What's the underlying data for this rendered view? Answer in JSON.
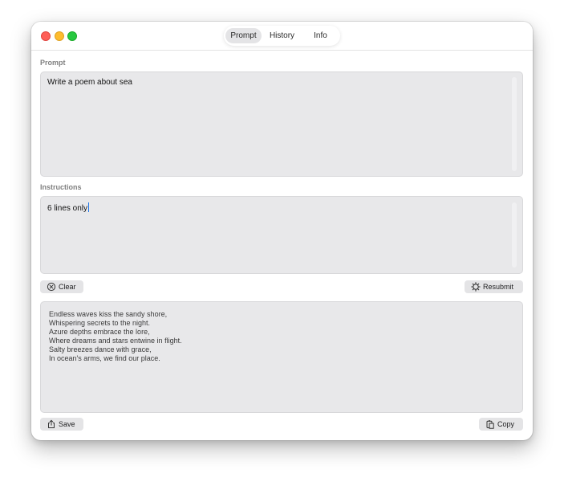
{
  "tabs": [
    {
      "label": "Prompt",
      "active": true
    },
    {
      "label": "History",
      "active": false
    },
    {
      "label": "Info",
      "active": false
    }
  ],
  "prompt": {
    "label": "Prompt",
    "value": "Write a poem about sea"
  },
  "instructions": {
    "label": "Instructions",
    "value": "6 lines only"
  },
  "actions": {
    "clear_label": "Clear",
    "resubmit_label": "Resubmit",
    "save_label": "Save",
    "copy_label": "Copy"
  },
  "output": {
    "lines": [
      "Endless waves kiss the sandy shore,",
      "Whispering secrets to the night.",
      "Azure depths embrace the lore,",
      "Where dreams and stars entwine in flight.",
      "Salty breezes dance with grace,",
      "In ocean's arms, we find our place."
    ]
  },
  "colors": {
    "close": "#fe5f57",
    "minimize": "#febc2e",
    "maximize": "#28c840",
    "caret": "#1a73e8"
  }
}
